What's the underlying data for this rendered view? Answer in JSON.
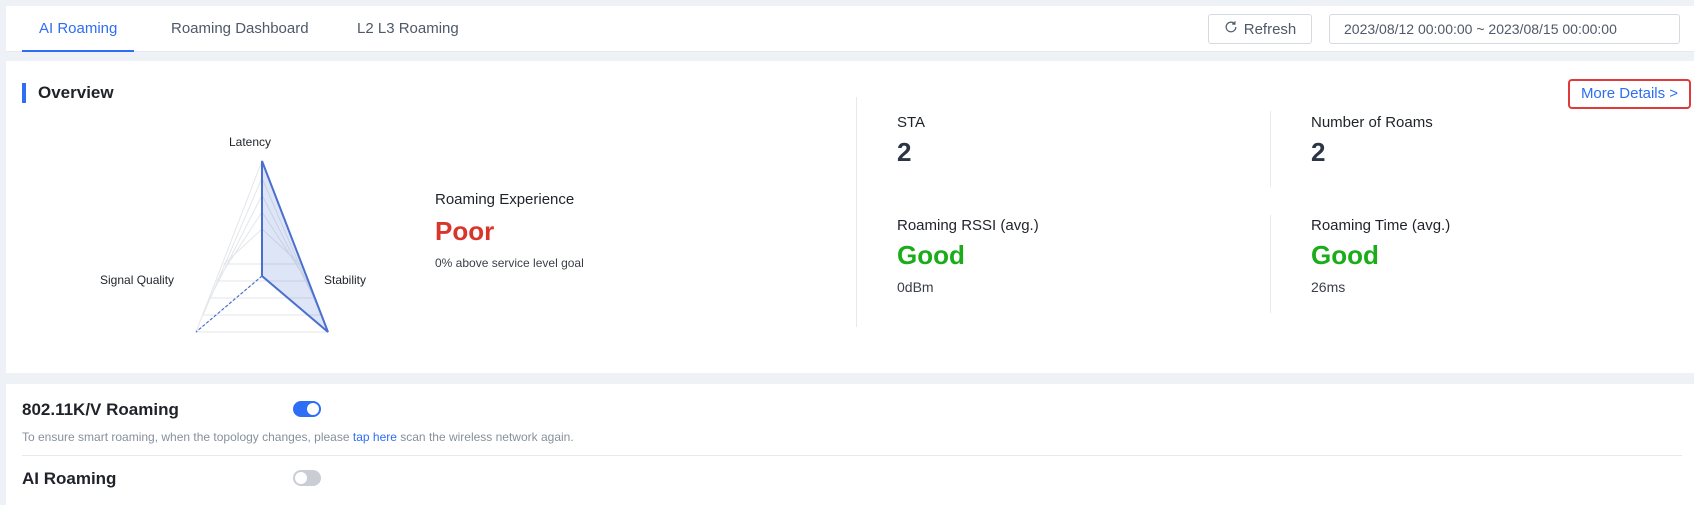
{
  "tabs": [
    {
      "label": "AI Roaming",
      "active": true
    },
    {
      "label": "Roaming Dashboard",
      "active": false
    },
    {
      "label": "L2 L3 Roaming",
      "active": false
    }
  ],
  "toolbar": {
    "refresh_label": "Refresh",
    "date_range": "2023/08/12 00:00:00 ~ 2023/08/15 00:00:00"
  },
  "overview": {
    "title": "Overview",
    "more_details": "More Details >",
    "radar": {
      "labels": [
        "Latency",
        "Signal Quality",
        "Stability"
      ],
      "line_color": "#4a6fcf"
    },
    "experience": {
      "label": "Roaming Experience",
      "value": "Poor",
      "note": "0% above service level goal",
      "color": "#d9362b"
    },
    "metrics": {
      "sta": {
        "label": "STA",
        "value": "2"
      },
      "roams": {
        "label": "Number of Roams",
        "value": "2"
      },
      "rssi": {
        "label": "Roaming RSSI (avg.)",
        "value": "Good",
        "sub": "0dBm"
      },
      "time": {
        "label": "Roaming Time (avg.)",
        "value": "Good",
        "sub": "26ms"
      }
    }
  },
  "settings": {
    "kv_roaming": {
      "title": "802.11K/V Roaming",
      "enabled": true,
      "desc_before": "To ensure smart roaming, when the topology changes, please ",
      "desc_link": "tap here",
      "desc_after": " scan the wireless network again."
    },
    "ai_roaming": {
      "title": "AI Roaming",
      "enabled": false
    }
  },
  "colors": {
    "accent": "#2e6df6",
    "good": "#1aad19",
    "poor": "#d9362b",
    "highlight_border": "#e03a3a"
  }
}
